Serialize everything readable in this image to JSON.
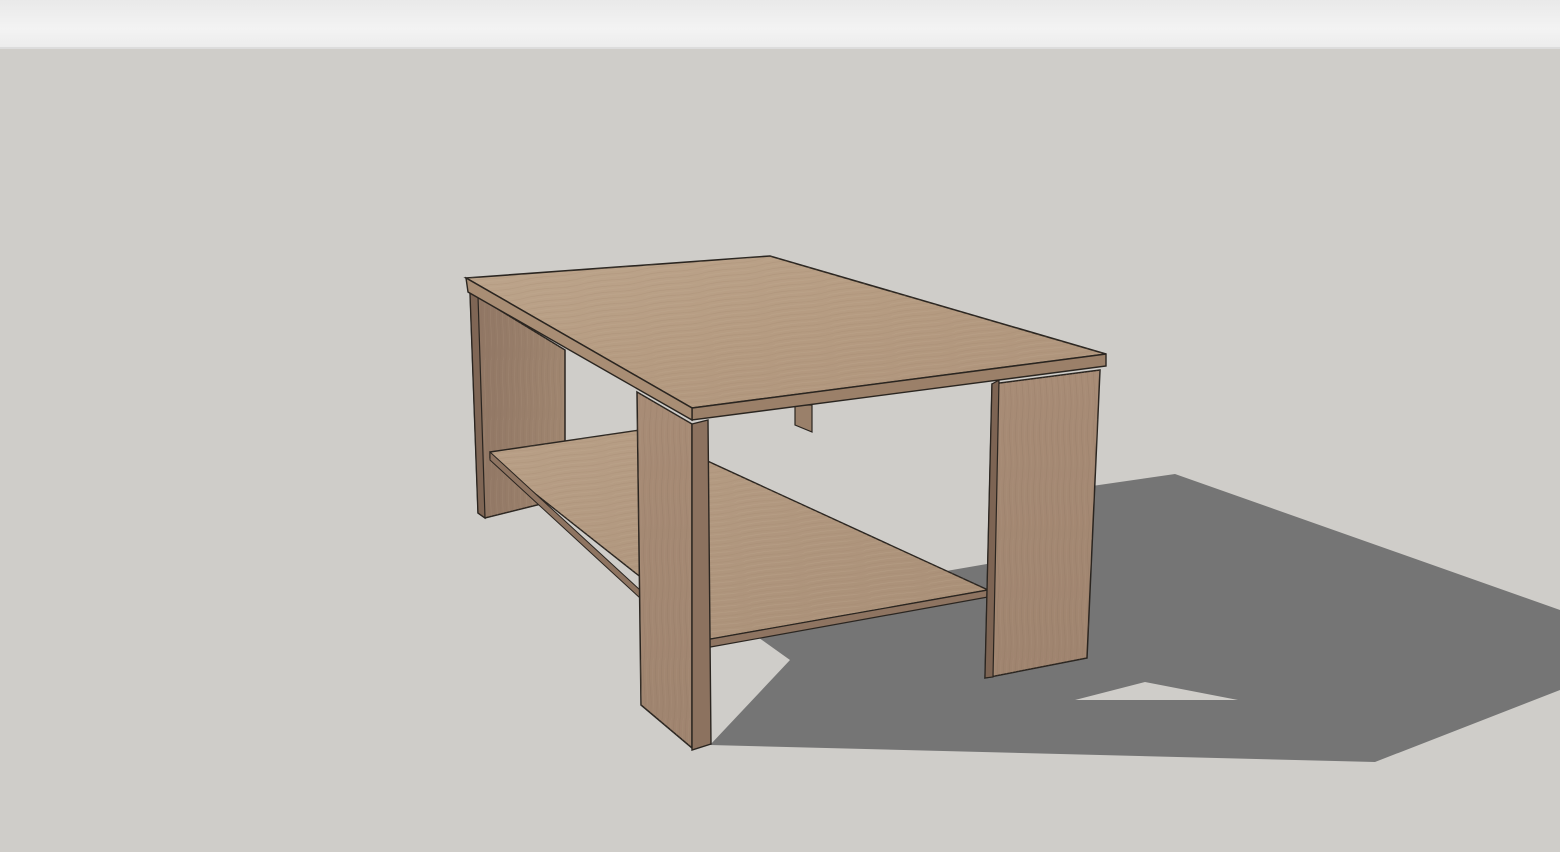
{
  "app": {
    "type": "3d-modeling-viewport"
  },
  "scene": {
    "object": "coffee-table",
    "background_colors": {
      "sky": "#f0f0f0",
      "ground": "#cfcdc9",
      "shadow": "#767676"
    },
    "material_colors": {
      "top_face": "#b69c83",
      "top_edge": "#a58a70",
      "panel_front": "#a58a75",
      "panel_side": "#9a7f6a",
      "shelf_top": "#b39a80",
      "edge_line": "#2a2520"
    }
  }
}
